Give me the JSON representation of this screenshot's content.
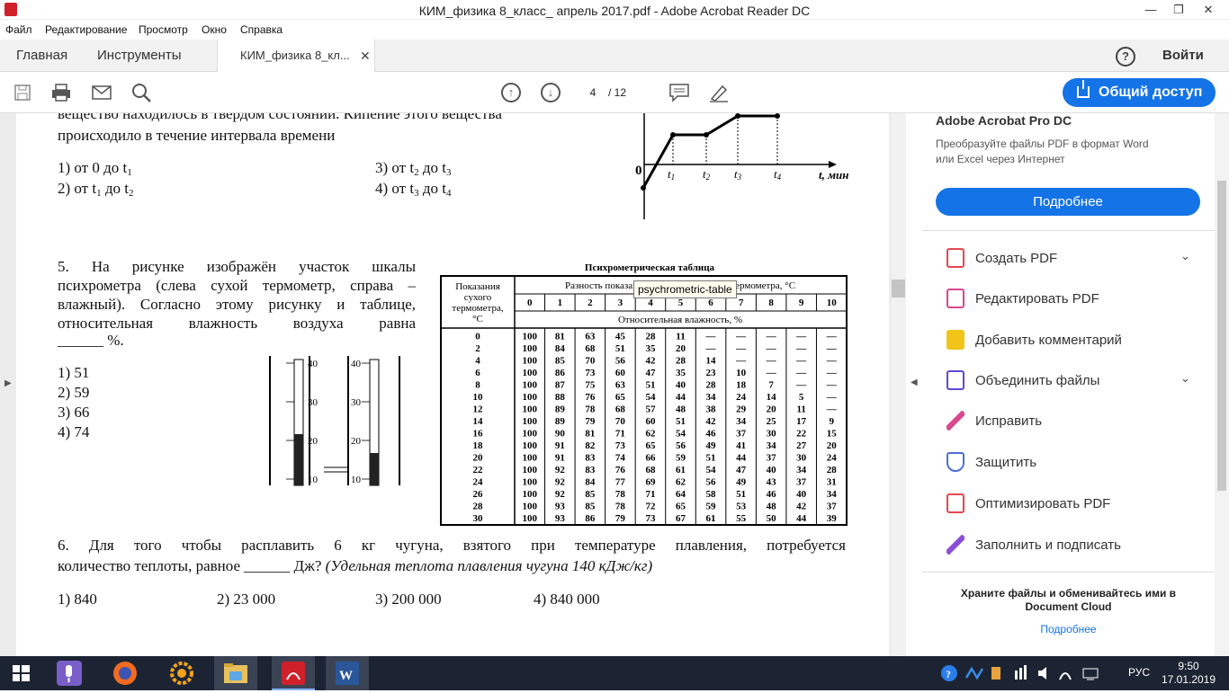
{
  "window": {
    "title": "КИМ_физика 8_класс_ апрель 2017.pdf - Adobe Acrobat Reader DC"
  },
  "menu": [
    "Файл",
    "Редактирование",
    "Просмотр",
    "Окно",
    "Справка"
  ],
  "tabs": {
    "home": "Главная",
    "tools": "Инструменты",
    "doc": "КИМ_физика 8_кл...",
    "signin": "Войти"
  },
  "toolbar": {
    "page_current": "4",
    "page_total": "/  12",
    "share": "Общий доступ"
  },
  "q4": {
    "line1": "вещество находилось в твердом состоянии. Кипение этого вещества",
    "line2": "происходило в течение интервала времени",
    "a1": "1) от 0 до t",
    "a1s": "1",
    "a2": "2) от t",
    "a2s": "1",
    "a2b": " до t",
    "a2bs": "2",
    "a3": "3) от t",
    "a3s": "2",
    "a3b": " до t",
    "a3bs": "3",
    "a4": "4) от t",
    "a4s": "3",
    "a4b": " до t",
    "a4bs": "4"
  },
  "graph": {
    "origin": "0",
    "t1": "t",
    "t1s": "1",
    "t2": "t",
    "t2s": "2",
    "t3": "t",
    "t3s": "3",
    "t4": "t",
    "t4s": "4",
    "axis": "t, мин"
  },
  "q5": {
    "l1": "5. На рисунке изображён участок шкалы",
    "l2": "психрометра (слева сухой термометр, справа –",
    "l3": "влажный). Согласно этому рисунку и таблице,",
    "l4": "относительная влажность воздуха равна",
    "l5": "______ %.",
    "a1": "1) 51",
    "a2": "2) 59",
    "a3": "3) 66",
    "a4": "4) 74"
  },
  "thermo": {
    "ticks": [
      "40",
      "30",
      "20",
      "10"
    ]
  },
  "table": {
    "title": "Психрометрическая таблица",
    "head_rows": "Показания сухого термометра, °С",
    "head_diff": "Разность показаний сухого и влажного термометра, °С",
    "head_rh": "Относительная влажность, %",
    "cols": [
      "0",
      "1",
      "2",
      "3",
      "4",
      "5",
      "6",
      "7",
      "8",
      "9",
      "10"
    ],
    "rows": [
      [
        "0",
        "100",
        "81",
        "63",
        "45",
        "28",
        "11",
        "—",
        "—",
        "—",
        "—",
        "—"
      ],
      [
        "2",
        "100",
        "84",
        "68",
        "51",
        "35",
        "20",
        "—",
        "—",
        "—",
        "—",
        "—"
      ],
      [
        "4",
        "100",
        "85",
        "70",
        "56",
        "42",
        "28",
        "14",
        "—",
        "—",
        "—",
        "—"
      ],
      [
        "6",
        "100",
        "86",
        "73",
        "60",
        "47",
        "35",
        "23",
        "10",
        "—",
        "—",
        "—"
      ],
      [
        "8",
        "100",
        "87",
        "75",
        "63",
        "51",
        "40",
        "28",
        "18",
        "7",
        "—",
        "—"
      ],
      [
        "10",
        "100",
        "88",
        "76",
        "65",
        "54",
        "44",
        "34",
        "24",
        "14",
        "5",
        "—"
      ],
      [
        "12",
        "100",
        "89",
        "78",
        "68",
        "57",
        "48",
        "38",
        "29",
        "20",
        "11",
        "—"
      ],
      [
        "14",
        "100",
        "89",
        "79",
        "70",
        "60",
        "51",
        "42",
        "34",
        "25",
        "17",
        "9"
      ],
      [
        "16",
        "100",
        "90",
        "81",
        "71",
        "62",
        "54",
        "46",
        "37",
        "30",
        "22",
        "15"
      ],
      [
        "18",
        "100",
        "91",
        "82",
        "73",
        "65",
        "56",
        "49",
        "41",
        "34",
        "27",
        "20"
      ],
      [
        "20",
        "100",
        "91",
        "83",
        "74",
        "66",
        "59",
        "51",
        "44",
        "37",
        "30",
        "24"
      ],
      [
        "22",
        "100",
        "92",
        "83",
        "76",
        "68",
        "61",
        "54",
        "47",
        "40",
        "34",
        "28"
      ],
      [
        "24",
        "100",
        "92",
        "84",
        "77",
        "69",
        "62",
        "56",
        "49",
        "43",
        "37",
        "31"
      ],
      [
        "26",
        "100",
        "92",
        "85",
        "78",
        "71",
        "64",
        "58",
        "51",
        "46",
        "40",
        "34"
      ],
      [
        "28",
        "100",
        "93",
        "85",
        "78",
        "72",
        "65",
        "59",
        "53",
        "48",
        "42",
        "37"
      ],
      [
        "30",
        "100",
        "93",
        "86",
        "79",
        "73",
        "67",
        "61",
        "55",
        "50",
        "44",
        "39"
      ]
    ]
  },
  "tooltip": "psychrometric-table",
  "q6": {
    "l1": "6. Для того чтобы расплавить 6 кг чугуна, взятого при температуре плавления, потребуется",
    "l2a": "количество теплоты, равное ______ Дж? ",
    "l2b": "(Удельная теплота плавления чугуна 140 кДж/кг)",
    "a1": "1) 840",
    "a2": "2) 23 000",
    "a3": "3) 200 000",
    "a4": "4) 840 000"
  },
  "rightpane": {
    "title": "Adobe Acrobat Pro DC",
    "desc": "Преобразуйте файлы PDF в формат Word\nили Excel через Интернет",
    "more": "Подробнее",
    "tools": [
      {
        "label": "Создать PDF",
        "color": "#e34850"
      },
      {
        "label": "Редактировать PDF",
        "color": "#d9478f"
      },
      {
        "label": "Добавить комментарий",
        "color": "#f0c419"
      },
      {
        "label": "Объединить файлы",
        "color": "#5c4bd3"
      },
      {
        "label": "Исправить",
        "color": "#d9478f"
      },
      {
        "label": "Защитить",
        "color": "#4d6fd6"
      },
      {
        "label": "Оптимизировать PDF",
        "color": "#e34850"
      },
      {
        "label": "Заполнить и подписать",
        "color": "#8a4fd6"
      }
    ],
    "cloud": "Храните файлы и обменивайтесь ими в Document Cloud",
    "cloud_link": "Подробнее"
  },
  "taskbar": {
    "lang": "РУС",
    "time": "9:50",
    "date": "17.01.2019"
  }
}
